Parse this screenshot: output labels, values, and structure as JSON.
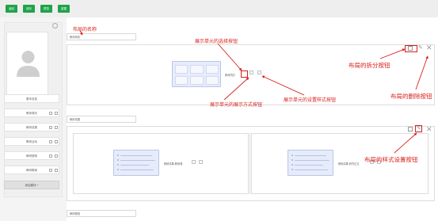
{
  "toolbar": {
    "buttons": [
      {
        "label": "返回"
      },
      {
        "label": "保存"
      },
      {
        "label": "预览"
      },
      {
        "label": "重置"
      }
    ],
    "accent_color": "#1fa34a"
  },
  "left_panel": {
    "items": [
      {
        "label": "基本信息"
      },
      {
        "label": "教师简历"
      },
      {
        "label": "教研成果"
      },
      {
        "label": "教研活动"
      },
      {
        "label": "教研随笔"
      },
      {
        "label": "教研教案"
      }
    ],
    "add_button": "添加模块 +"
  },
  "layouts": [
    {
      "name": "教师简历"
    },
    {
      "name": "教研成果"
    },
    {
      "name": "教研随笔"
    }
  ],
  "units": {
    "resume_unit": "教师简历",
    "unit_a": "教研成果-教研课",
    "unit_b": "教研成果-研究论文"
  },
  "annotations": {
    "layout_name": "布局的名称",
    "select_button": "展示单元的选择按钮",
    "split_button": "布局的拆分按钮",
    "delete_button": "布局的删除按钮",
    "display_mode_button": "展示单元的展示方式按钮",
    "style_button": "展示单元的设置样式按钮",
    "layout_style_button": "布局的样式设置按钮",
    "color": "#d8201c"
  }
}
